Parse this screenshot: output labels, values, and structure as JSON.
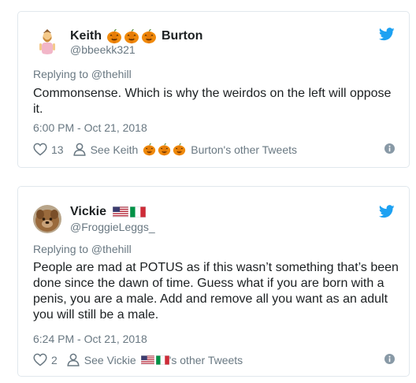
{
  "tweets": [
    {
      "display_name_first": "Keith",
      "display_name_last": "Burton",
      "name_emoji": [
        "pumpkin",
        "pumpkin",
        "pumpkin"
      ],
      "handle": "@bbeekk321",
      "replying_to": "Replying to @thehill",
      "text": "Commonsense. Which is why the weirdos on the left will oppose it.",
      "timestamp": "6:00 PM - Oct 21, 2018",
      "likes": "13",
      "other_tweets_prefix": "See Keith",
      "other_tweets_suffix": "Burton's other Tweets"
    },
    {
      "display_name_first": "Vickie",
      "display_name_last": "",
      "name_emoji": [
        "flag-us",
        "flag-italy"
      ],
      "handle": "@FroggieLeggs_",
      "replying_to": "Replying to @thehill",
      "text": "People are mad at POTUS as if this wasn’t something that’s been done since the dawn of time. Guess what if you are born with a penis, you are a male. Add and remove all you want as an adult you will still be a male.",
      "timestamp": "6:24 PM - Oct 21, 2018",
      "likes": "2",
      "other_tweets_prefix": "See Vickie",
      "other_tweets_suffix": "'s other Tweets"
    }
  ],
  "colors": {
    "text": "#1c2022",
    "muted": "#697882",
    "twitter_blue": "#1da1f2",
    "border": "#e1e8ed",
    "pumpkin": "#f08a0c"
  }
}
